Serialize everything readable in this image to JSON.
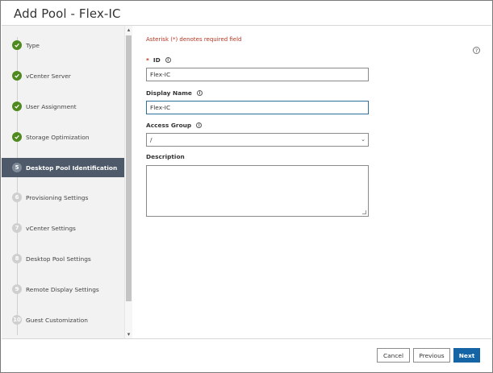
{
  "dialog": {
    "title": "Add Pool - Flex-IC"
  },
  "sidebar": {
    "steps": [
      {
        "badge": "",
        "label": "Type",
        "state": "done"
      },
      {
        "badge": "",
        "label": "vCenter Server",
        "state": "done"
      },
      {
        "badge": "",
        "label": "User Assignment",
        "state": "done"
      },
      {
        "badge": "",
        "label": "Storage Optimization",
        "state": "done"
      },
      {
        "badge": "5",
        "label": "Desktop Pool Identification",
        "state": "active"
      },
      {
        "badge": "6",
        "label": "Provisioning Settings",
        "state": "pending"
      },
      {
        "badge": "7",
        "label": "vCenter Settings",
        "state": "pending"
      },
      {
        "badge": "8",
        "label": "Desktop Pool Settings",
        "state": "pending"
      },
      {
        "badge": "9",
        "label": "Remote Display Settings",
        "state": "pending"
      },
      {
        "badge": "10",
        "label": "Guest Customization",
        "state": "pending"
      }
    ]
  },
  "form": {
    "required_note": "Asterisk (*) denotes required field",
    "help_icon": "?",
    "id_field": {
      "required_marker": "*",
      "label": "ID",
      "value": "Flex-IC"
    },
    "display_name_field": {
      "label": "Display Name",
      "value": "Flex-IC"
    },
    "access_group_field": {
      "label": "Access Group",
      "value": "/"
    },
    "description_field": {
      "label": "Description",
      "value": ""
    }
  },
  "footer": {
    "cancel_label": "Cancel",
    "previous_label": "Previous",
    "next_label": "Next"
  },
  "colors": {
    "active_step_bg": "#4e5a69",
    "done_badge": "#4e8a1e",
    "primary_button": "#1565a6",
    "required_red": "#b5341f"
  }
}
